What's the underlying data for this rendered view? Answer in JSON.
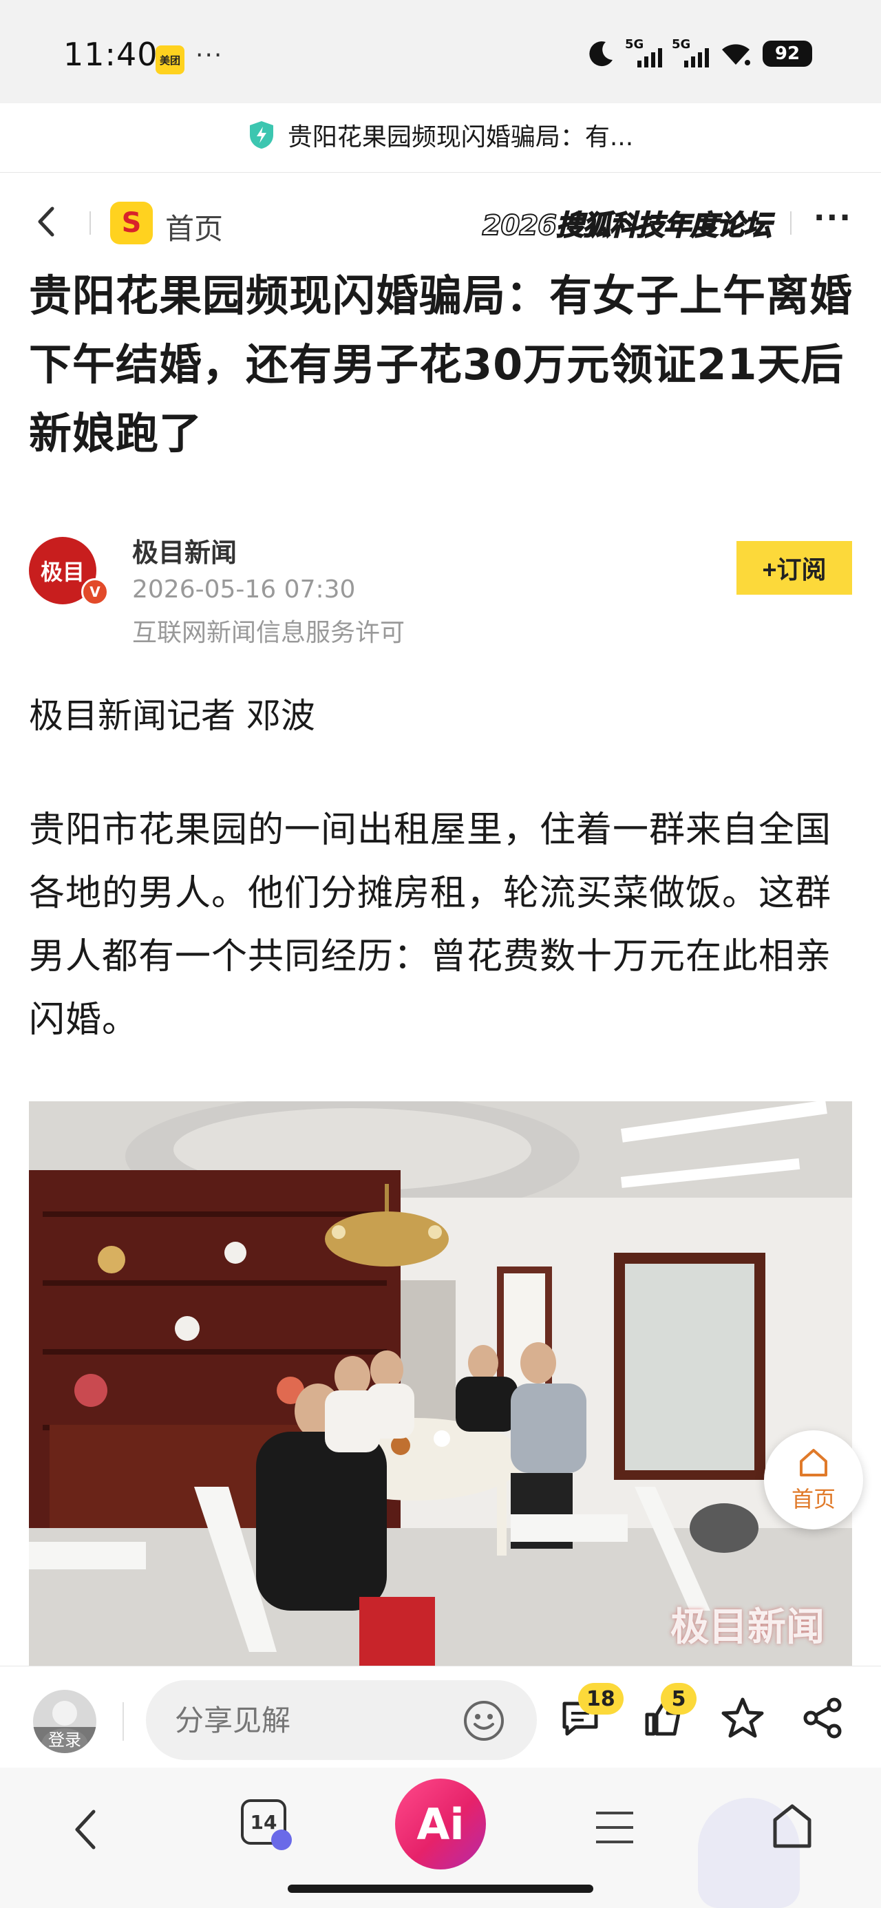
{
  "status_bar": {
    "time": "11:40",
    "app_badge": "美团",
    "more": "···",
    "sim1": "5G",
    "sim2": "5G",
    "battery": "92"
  },
  "notice": {
    "text": "贵阳花果园频现闪婚骗局：有..."
  },
  "header": {
    "logo_letter": "S",
    "home_label": "首页",
    "forum_title": "2026搜狐科技年度论坛",
    "more": "···"
  },
  "article": {
    "title": "贵阳花果园频现闪婚骗局：有女子上午离婚下午结婚，还有男子花30万元领证21天后新娘跑了",
    "source": {
      "avatar_text": "极目",
      "verified_mark": "V",
      "name": "极目新闻",
      "date": "2026-05-16 07:30",
      "license": "互联网新闻信息服务许可"
    },
    "subscribe_label": "+订阅",
    "reporter": "极目新闻记者 邓波",
    "paragraph": "贵阳市花果园的一间出租屋里，住着一群来自全国各地的男人。他们分摊房租，轮流买菜做饭。这群男人都有一个共同经历：曾花费数十万元在此相亲闪婚。",
    "photo_watermark": "极目新闻"
  },
  "float_home": {
    "label": "首页"
  },
  "action_bar": {
    "login_label": "登录",
    "share_placeholder": "分享见解",
    "comments_count": "18",
    "likes_count": "5"
  },
  "nav_bar": {
    "tabs_count": "14",
    "ai_label": "Ai"
  },
  "colors": {
    "accent_yellow": "#fcd93a",
    "brand_red": "#c81e1e",
    "ai_pink": "#e6226a",
    "float_orange": "#e07a2a"
  }
}
